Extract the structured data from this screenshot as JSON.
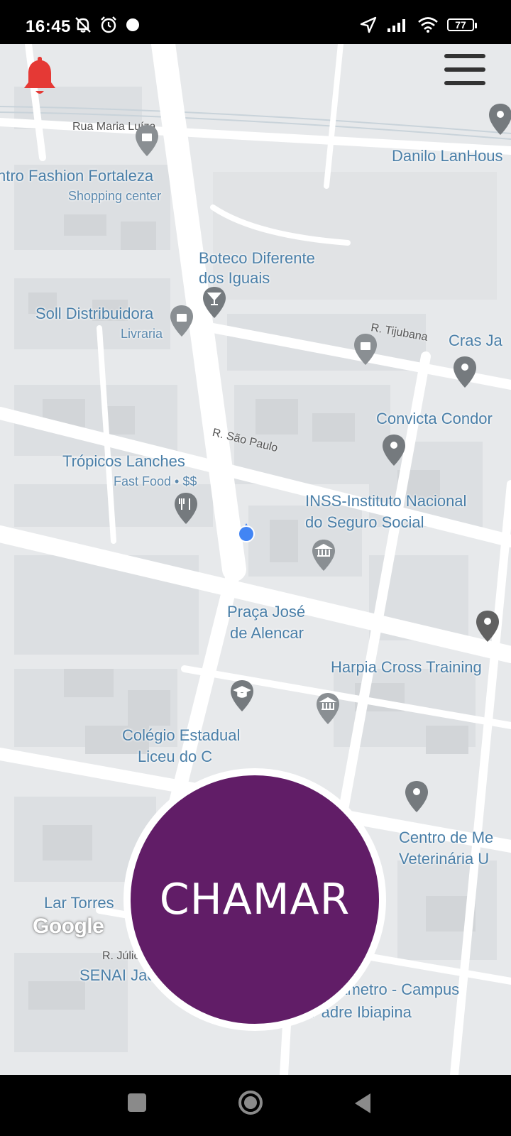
{
  "status": {
    "time": "16:45",
    "battery": "77"
  },
  "map": {
    "labels": {
      "rua_maria_luiza": "Rua Maria Luíza",
      "fashion_name": "ntro Fashion Fortaleza",
      "fashion_sub": "Shopping center",
      "danilo": "Danilo LanHous",
      "boteco_1": "Boteco Diferente",
      "boteco_2": "dos Iguais",
      "soll": "Soll Distribuidora",
      "soll_sub": "Livraria",
      "tijubana": "R. Tijubana",
      "cras": "Cras Ja",
      "convicta": "Convicta Condor",
      "sao_paulo": "R. São Paulo",
      "tropicos": "Trópicos Lanches",
      "tropicos_sub": "Fast Food • $$",
      "inss_1": "INSS-Instituto Nacional",
      "inss_2": "do Seguro Social",
      "praca_1": "Praça José",
      "praca_2": "de Alencar",
      "harpia": "Harpia Cross Training",
      "colegio_1": "Colégio Estadual",
      "colegio_2": "Liceu do C",
      "centro_1": "Centro de Me",
      "centro_2": "Veterinária U",
      "lar": "Lar Torres",
      "julio": "R. Júlic",
      "senai": "SENAI Jac",
      "unifametro": "nifametro - Campus",
      "padre": "Padre Ibiapina"
    },
    "google_logo": "Google",
    "icons": {
      "alert": "bell-icon",
      "menu": "hamburger-menu-icon",
      "location": "user-location-icon"
    }
  },
  "call_button": {
    "label": "CHAMAR"
  },
  "colors": {
    "call_button": "#611d67",
    "bell": "#e53935",
    "map_background": "#e7e9eb",
    "label_blue": "#4a7fa8",
    "location_blue": "#4285f4"
  }
}
